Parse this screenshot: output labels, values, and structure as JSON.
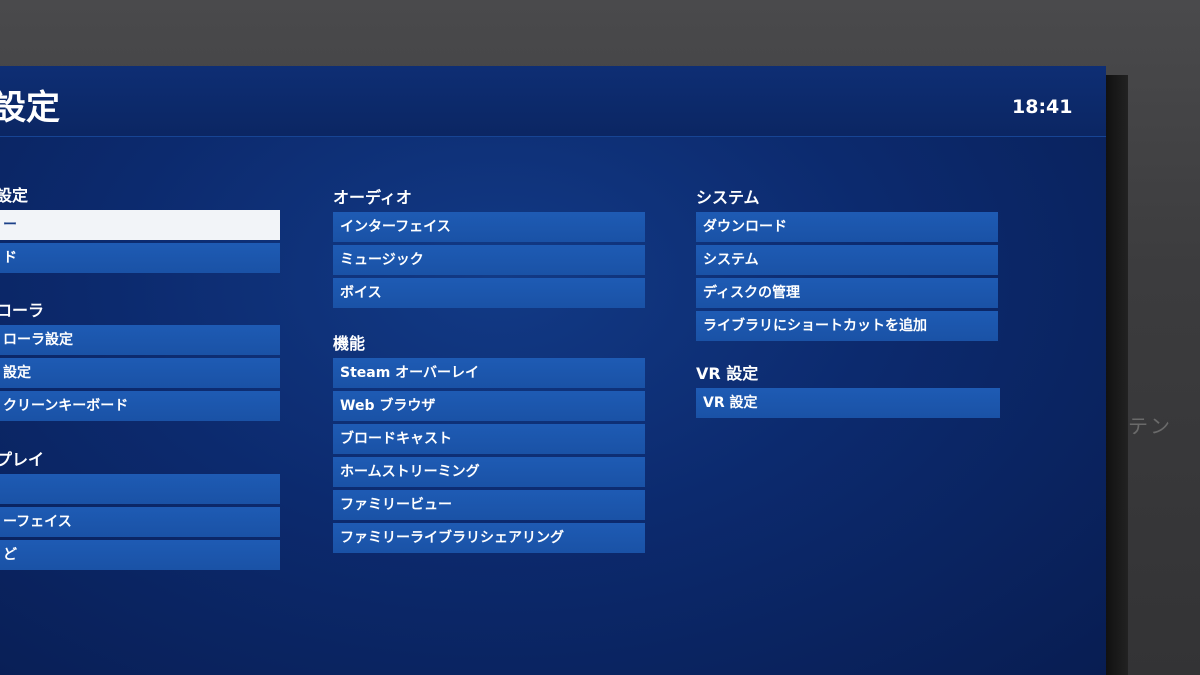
{
  "header": {
    "title": "設定",
    "clock": "18:41"
  },
  "columns": {
    "left": [
      {
        "title": "設定",
        "items": [
          "ー",
          "ド"
        ]
      },
      {
        "title": "ローラ",
        "items": [
          "ローラ設定",
          "設定",
          "クリーンキーボード"
        ]
      },
      {
        "title": "プレイ",
        "items": [
          "",
          "ーフェイス",
          "ど"
        ]
      }
    ],
    "middle": [
      {
        "title": "オーディオ",
        "items": [
          "インターフェイス",
          "ミュージック",
          "ボイス"
        ]
      },
      {
        "title": "機能",
        "items": [
          "Steam オーバーレイ",
          "Web ブラウザ",
          "ブロードキャスト",
          "ホームストリーミング",
          "ファミリービュー",
          "ファミリーライブラリシェアリング"
        ]
      }
    ],
    "right": [
      {
        "title": "システム",
        "items": [
          "ダウンロード",
          "システム",
          "ディスクの管理",
          "ライブラリにショートカットを追加"
        ]
      },
      {
        "title": "VR 設定",
        "items": [
          "VR 設定"
        ]
      }
    ]
  },
  "background_side_text": "テン",
  "colors": {
    "screen_bg": "#0c2a6e",
    "item_bg": "#1e5bb4",
    "selected_bg": "#f2f4f8",
    "text": "#ffffff"
  }
}
